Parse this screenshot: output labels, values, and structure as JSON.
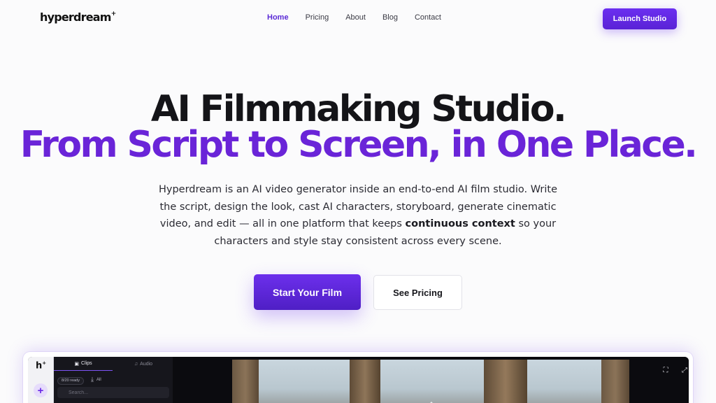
{
  "brand": {
    "logo": "hyperdream",
    "logo_mark": "+"
  },
  "nav": {
    "links": [
      "Home",
      "Pricing",
      "About",
      "Blog",
      "Contact"
    ],
    "active": "Home",
    "cta": "Launch Studio"
  },
  "hero": {
    "line1": "AI Filmmaking Studio.",
    "line2": "From Script to Screen, in One Place.",
    "desc_before": "Hyperdream is an AI video generator inside an end-to-end AI film studio. Write the script, design the look, cast AI characters, storyboard, generate cinematic video, and edit — all in one platform that keeps ",
    "desc_bold": "continuous context",
    "desc_after": " so your characters and style stay consistent across every scene.",
    "primary_cta": "Start Your Film",
    "secondary_cta": "See Pricing"
  },
  "app_preview": {
    "rail_logo": "h",
    "rail_add": "+",
    "tabs": [
      {
        "label": "Clips",
        "icon": "clip-icon"
      },
      {
        "label": "Audio",
        "icon": "audio-icon"
      }
    ],
    "ready_badge": "8/20 ready",
    "download_all": "All",
    "search_placeholder": "Search..."
  },
  "colors": {
    "accent": "#6a24d8",
    "button": "#5b24d8",
    "dark_app": "#0d0d12"
  }
}
